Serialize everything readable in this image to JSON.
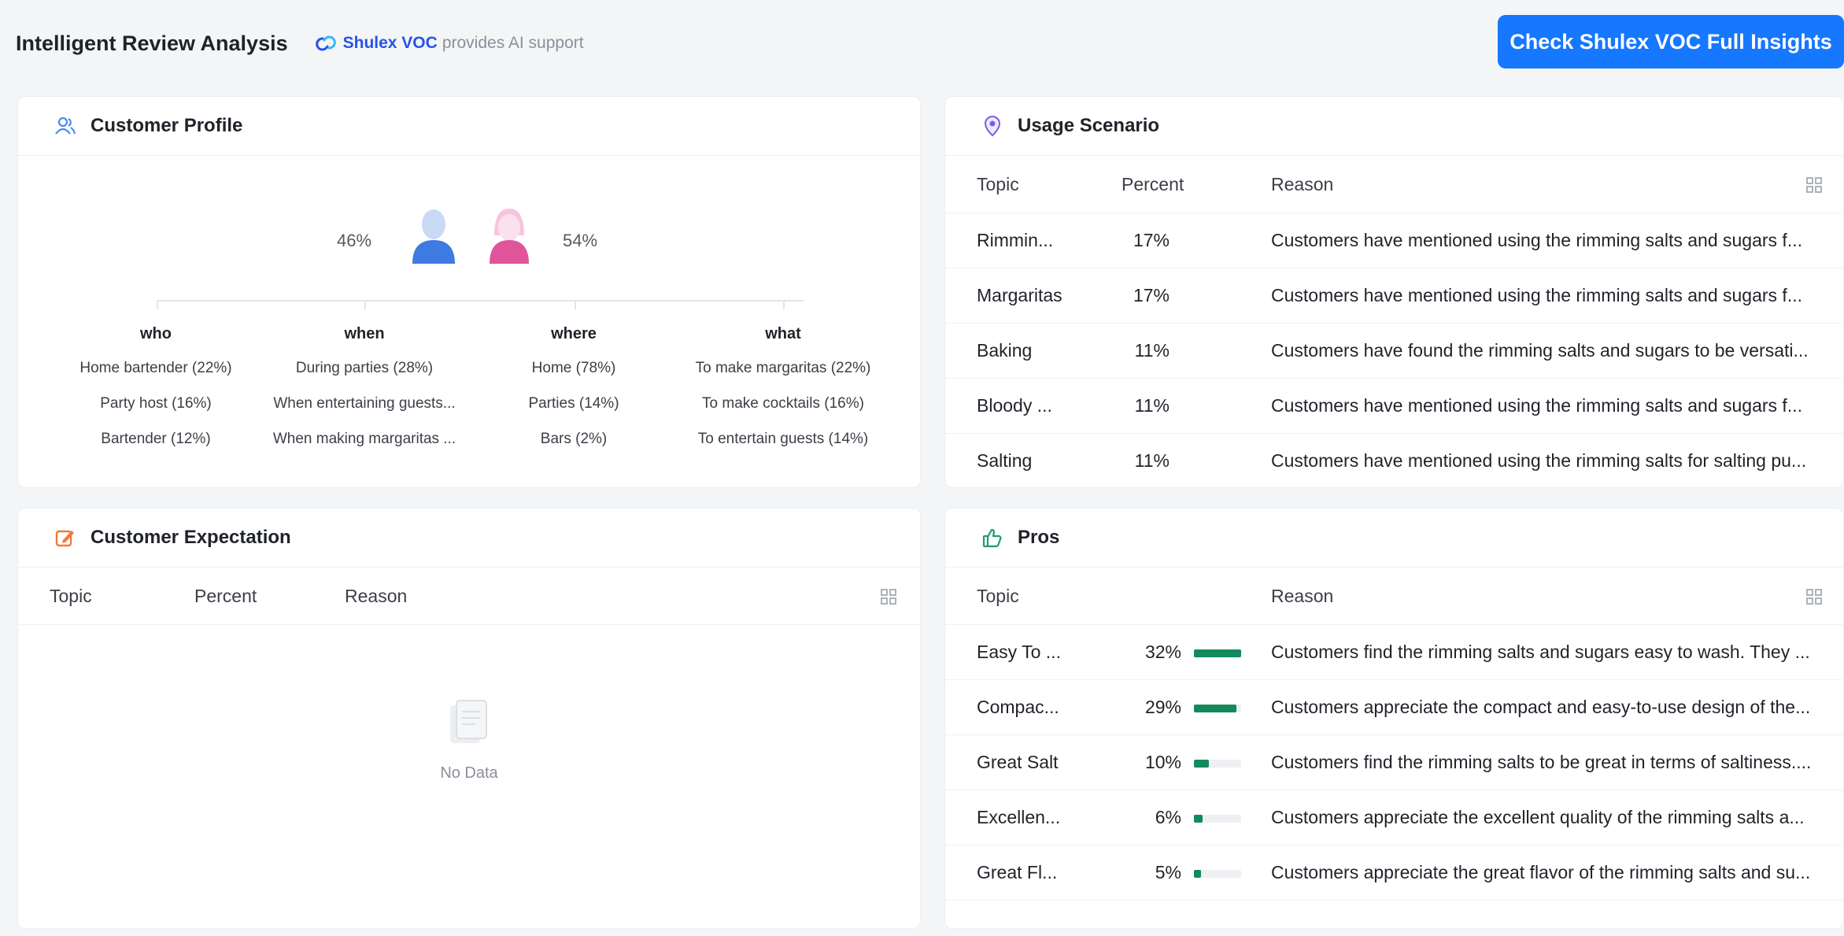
{
  "header": {
    "title": "Intelligent Review Analysis",
    "brand": "Shulex VOC",
    "ai_text": "provides AI support",
    "cta": "Check Shulex VOC Full Insights"
  },
  "colors": {
    "accent": "#1677ff",
    "brand": "#2554e8",
    "male": "#3d7be0",
    "female": "#e0559a",
    "bar": "#128a5c"
  },
  "profile": {
    "title": "Customer Profile",
    "male_pct": "46%",
    "female_pct": "54%",
    "columns": [
      {
        "head": "who",
        "items": [
          "Home bartender (22%)",
          "Party host (16%)",
          "Bartender (12%)"
        ]
      },
      {
        "head": "when",
        "items": [
          "During parties (28%)",
          "When entertaining guests...",
          "When making margaritas ..."
        ]
      },
      {
        "head": "where",
        "items": [
          "Home (78%)",
          "Parties (14%)",
          "Bars (2%)"
        ]
      },
      {
        "head": "what",
        "items": [
          "To make margaritas (22%)",
          "To make cocktails (16%)",
          "To entertain guests (14%)"
        ]
      }
    ]
  },
  "expectation": {
    "title": "Customer Expectation",
    "headers": {
      "topic": "Topic",
      "percent": "Percent",
      "reason": "Reason"
    },
    "empty": "No Data"
  },
  "usage": {
    "title": "Usage Scenario",
    "headers": {
      "topic": "Topic",
      "percent": "Percent",
      "reason": "Reason"
    },
    "rows": [
      {
        "topic": "Rimmin...",
        "percent": "17%",
        "reason": "Customers have mentioned using the rimming salts and sugars f..."
      },
      {
        "topic": "Margaritas",
        "percent": "17%",
        "reason": "Customers have mentioned using the rimming salts and sugars f..."
      },
      {
        "topic": "Baking",
        "percent": "11%",
        "reason": "Customers have found the rimming salts and sugars to be versati..."
      },
      {
        "topic": "Bloody ...",
        "percent": "11%",
        "reason": "Customers have mentioned using the rimming salts and sugars f..."
      },
      {
        "topic": "Salting",
        "percent": "11%",
        "reason": "Customers have mentioned using the rimming salts for salting pu..."
      }
    ]
  },
  "pros": {
    "title": "Pros",
    "headers": {
      "topic": "Topic",
      "reason": "Reason"
    },
    "rows": [
      {
        "topic": "Easy To ...",
        "percent": "32%",
        "level": 0.32,
        "reason": "Customers find the rimming salts and sugars easy to wash. They ..."
      },
      {
        "topic": "Compac...",
        "percent": "29%",
        "level": 0.29,
        "reason": "Customers appreciate the compact and easy-to-use design of the..."
      },
      {
        "topic": "Great Salt",
        "percent": "10%",
        "level": 0.1,
        "reason": "Customers find the rimming salts to be great in terms of saltiness...."
      },
      {
        "topic": "Excellen...",
        "percent": "6%",
        "level": 0.06,
        "reason": "Customers appreciate the excellent quality of the rimming salts a..."
      },
      {
        "topic": "Great Fl...",
        "percent": "5%",
        "level": 0.05,
        "reason": "Customers appreciate the great flavor of the rimming salts and su..."
      }
    ]
  }
}
